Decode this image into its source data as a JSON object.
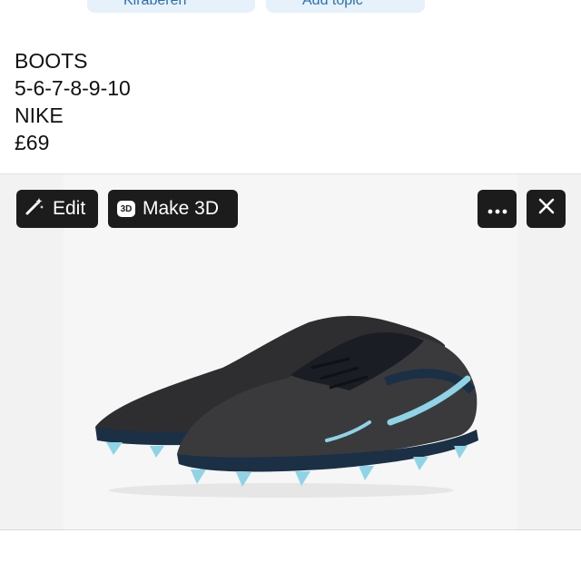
{
  "top_bar": {
    "left_chip_label": "Kiraberen",
    "right_chip_label": "Add topic"
  },
  "post": {
    "lines": [
      "BOOTS",
      "5-6-7-8-9-10",
      "NIKE",
      "£69"
    ]
  },
  "image_toolbar": {
    "edit_label": "Edit",
    "make3d_label": "Make 3D",
    "make3d_badge": "3D"
  },
  "image": {
    "subject": "boots-image",
    "colors": {
      "upper": "#3a3a3c",
      "collar": "#1a1d24",
      "accent": "#8fd3e6",
      "trim": "#1b2f45"
    }
  }
}
